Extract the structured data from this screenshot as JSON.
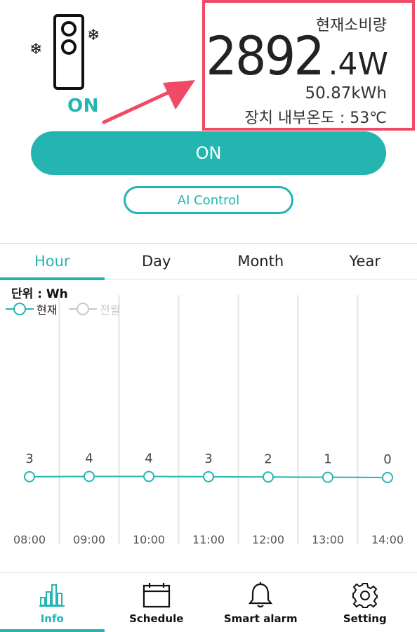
{
  "device": {
    "state": "ON",
    "icon": "cooling-device-icon",
    "snow_icon": "❄"
  },
  "power": {
    "label": "현재소비량",
    "integer": "2892",
    "decimal": ".4",
    "unit": "W",
    "energy": "50.87kWh",
    "temperature": "장치 내부온도 : 53℃"
  },
  "controls": {
    "on_label": "ON",
    "ai_label": "AI Control"
  },
  "tabs": [
    {
      "label": "Hour",
      "active": true
    },
    {
      "label": "Day",
      "active": false
    },
    {
      "label": "Month",
      "active": false
    },
    {
      "label": "Year",
      "active": false
    }
  ],
  "chart_header": {
    "unit": "단위 : Wh",
    "legend_current": "현재",
    "legend_previous": "전월"
  },
  "chart_data": {
    "type": "line",
    "x": [
      "08:00",
      "09:00",
      "10:00",
      "11:00",
      "12:00",
      "13:00",
      "14:00"
    ],
    "series": [
      {
        "name": "현재",
        "values": [
          3,
          4,
          4,
          3,
          2,
          1,
          0
        ]
      }
    ],
    "data_labels": true,
    "grid": "vertical",
    "legend": "top-left"
  },
  "colors": {
    "accent": "#24b5b1",
    "highlight_border": "#ef4b67",
    "legend_inactive": "#c8c8c8"
  },
  "bottom_nav": [
    {
      "label": "Info",
      "icon": "bar-chart-icon",
      "active": true
    },
    {
      "label": "Schedule",
      "icon": "calendar-icon",
      "active": false
    },
    {
      "label": "Smart alarm",
      "icon": "bell-icon",
      "active": false
    },
    {
      "label": "Setting",
      "icon": "gear-icon",
      "active": false
    }
  ]
}
